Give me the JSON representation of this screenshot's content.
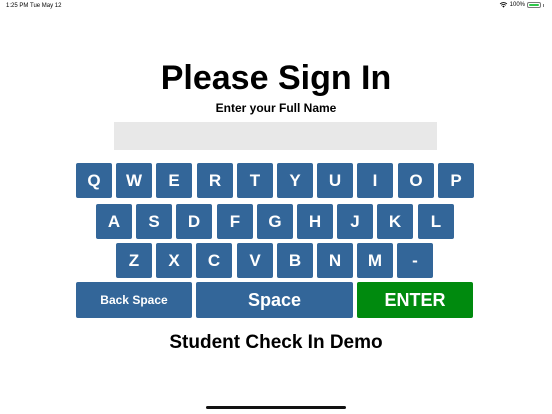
{
  "status_bar": {
    "time": "1:25 PM",
    "date": "Tue May 12",
    "battery": "100%",
    "battery_level": 1.0
  },
  "header": {
    "title": "Please Sign In",
    "subtitle": "Enter your Full Name"
  },
  "name_input": {
    "value": "",
    "placeholder": ""
  },
  "keyboard": {
    "rows": [
      [
        "Q",
        "W",
        "E",
        "R",
        "T",
        "Y",
        "U",
        "I",
        "O",
        "P"
      ],
      [
        "A",
        "S",
        "D",
        "F",
        "G",
        "H",
        "J",
        "K",
        "L"
      ],
      [
        "Z",
        "X",
        "C",
        "V",
        "B",
        "N",
        "M",
        "-"
      ]
    ],
    "back_label": "Back Space",
    "space_label": "Space",
    "enter_label": "ENTER"
  },
  "footer": {
    "label": "Student Check In Demo"
  },
  "colors": {
    "key": "#336699",
    "enter": "#008a0e",
    "input_bg": "#e8e8e8"
  }
}
